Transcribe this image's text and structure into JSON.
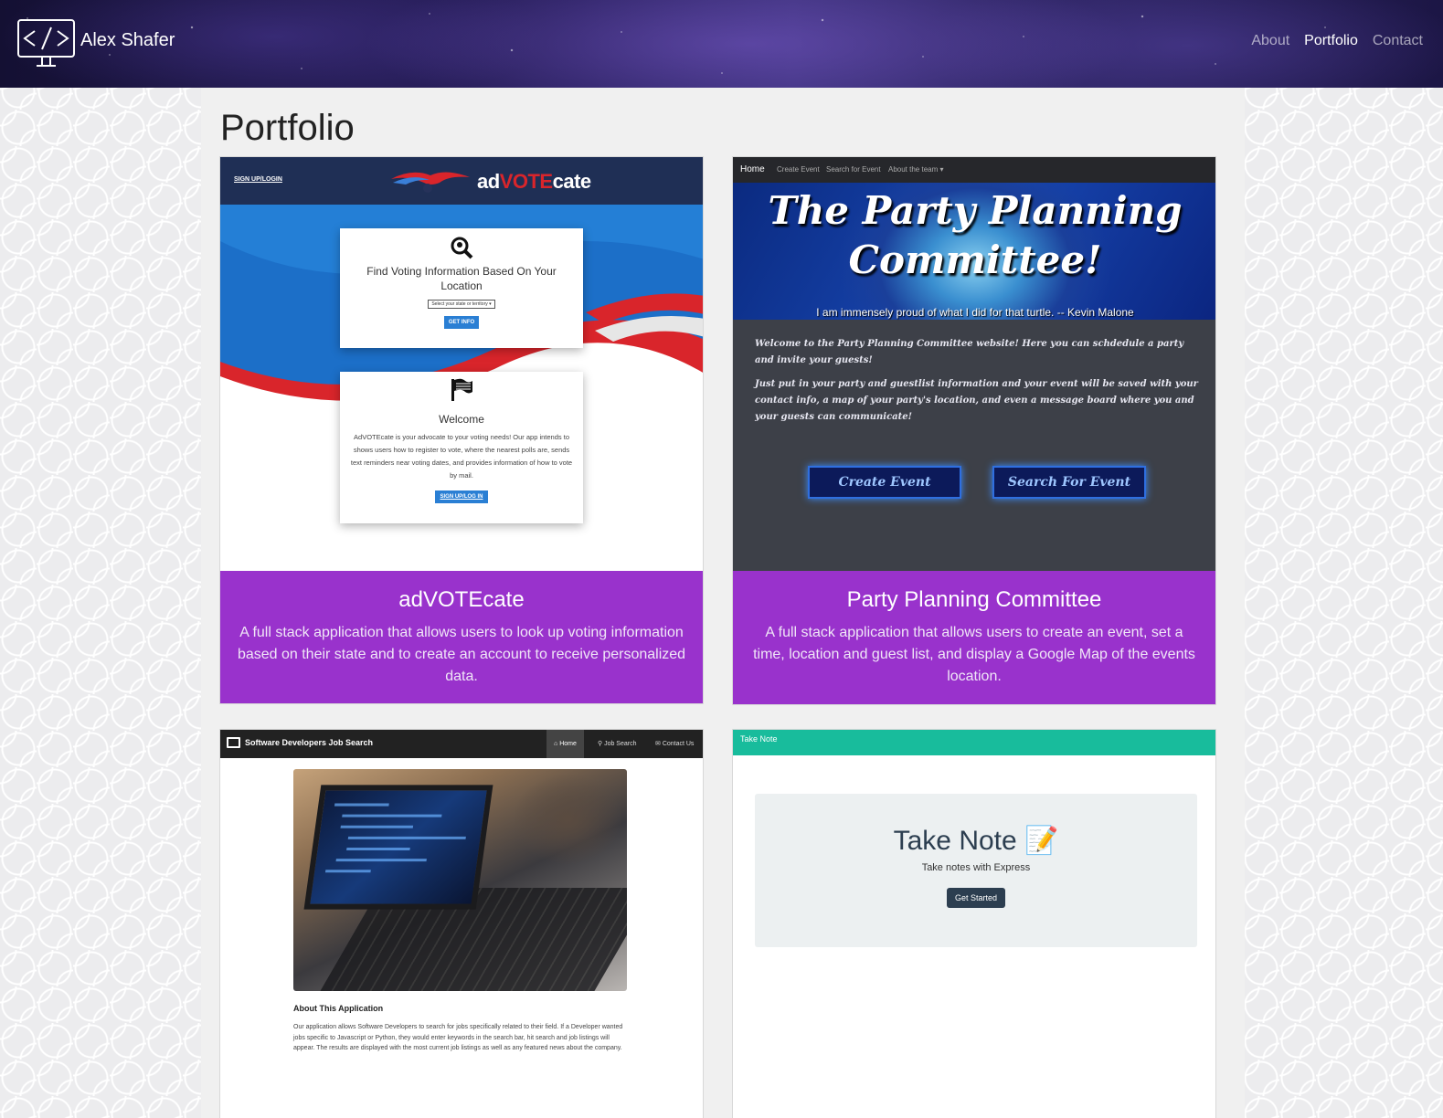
{
  "navbar": {
    "brand_name": "Alex Shafer",
    "links": [
      "About",
      "Portfolio",
      "Contact"
    ],
    "active_link": "Portfolio"
  },
  "page": {
    "title": "Portfolio"
  },
  "cards": [
    {
      "title": "adVOTEcate",
      "description": "A full stack application that allows users to look up voting information based on their state and to create an account to receive personalized data.",
      "preview": {
        "signup_link": "SIGN UP/LOGIN",
        "wordmark_prefix": "ad",
        "wordmark_vote": "VOTE",
        "wordmark_suffix": "cate",
        "box1_title": "Find Voting Information Based On Your Location",
        "select_placeholder": "Select your state or territory",
        "get_info_button": "GET INFO",
        "box2_title": "Welcome",
        "box2_text": "AdVOTEcate is your advocate to your voting needs! Our app intends to shows users how to register to vote, where the nearest polls are, sends text reminders near voting dates, and provides information of how to vote by mail.",
        "signup_button": "SIGN UP/LOG IN"
      }
    },
    {
      "title": "Party Planning Committee",
      "description": "A full stack application that allows users to create an event, set a time, location and guest list, and display a Google Map of the events location.",
      "preview": {
        "nav": [
          "Home",
          "Create Event",
          "Search for Event",
          "About the team ▾"
        ],
        "hero_title_line1": "The Party Planning",
        "hero_title_line2": "Committee!",
        "hero_quote": "I am immensely proud of what I did for that turtle. -- Kevin Malone",
        "body_p1": "Welcome to the Party Planning Committee website! Here you can schdedule a party and invite your guests!",
        "body_p2": "Just put in your party and guestlist information and your event will be saved with your contact info, a map of your party's location, and even a message board where you and your guests can communicate!",
        "create_button": "Create Event",
        "search_button": "Search For Event"
      }
    },
    {
      "preview": {
        "brand": "Software Developers Job Search",
        "nav": [
          "Home",
          "Job Search",
          "Contact Us"
        ],
        "about_title": "About This Application",
        "about_text": "Our application allows Software Developers to search for jobs specifically related to their field. If a Developer wanted jobs specific to Javascript or Python, they would enter keywords in the search bar, hit search and job listings will appear. The results are displayed with the most current job listings as well as any featured news about the company."
      }
    },
    {
      "preview": {
        "nav_brand": "Take Note",
        "title": "Take Note",
        "title_emoji": "📝",
        "subtitle": "Take notes with Express",
        "button": "Get Started"
      }
    }
  ]
}
